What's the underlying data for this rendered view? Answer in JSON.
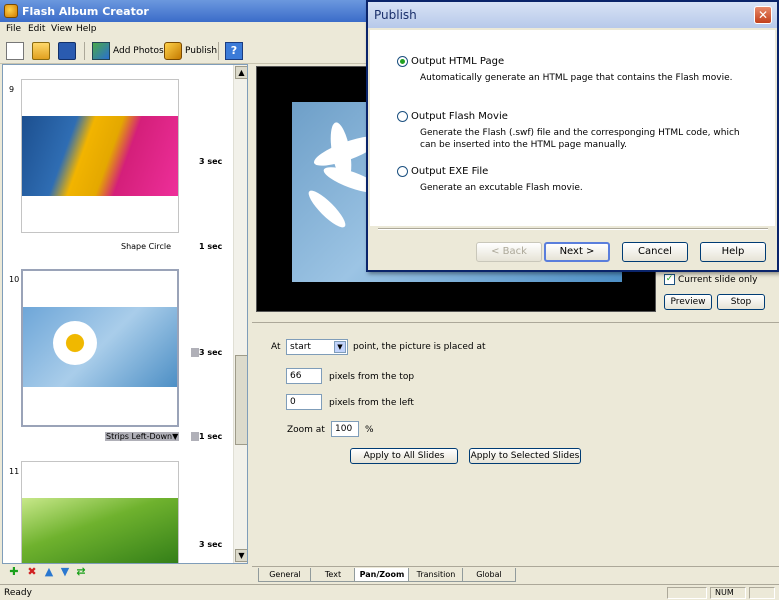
{
  "window": {
    "title": "Flash Album Creator"
  },
  "menu": [
    "File",
    "Edit",
    "View",
    "Help"
  ],
  "toolbar": {
    "add_photos": "Add Photos",
    "publish": "Publish"
  },
  "slides": [
    {
      "num": "9",
      "duration": "3 sec",
      "transition": "Shape Circle",
      "transition_duration": "1 sec"
    },
    {
      "num": "10",
      "duration": "3 sec",
      "transition": "Strips Left-Down▼",
      "transition_duration": "1 sec"
    },
    {
      "num": "11",
      "duration": "3 sec"
    }
  ],
  "preview": {
    "current_slide_only": "Current slide only",
    "preview_btn": "Preview",
    "stop_btn": "Stop"
  },
  "panzoom": {
    "at_label": "At",
    "point_select": "start",
    "point_suffix": "point, the picture is placed at",
    "top_value": "66",
    "top_label": "pixels from the top",
    "left_value": "0",
    "left_label": "pixels from the left",
    "zoom_label": "Zoom at",
    "zoom_value": "100",
    "zoom_unit": "%",
    "apply_all": "Apply to All Slides",
    "apply_selected": "Apply to Selected Slides"
  },
  "tabs": [
    "General",
    "Text",
    "Pan/Zoom",
    "Transition",
    "Global"
  ],
  "status": {
    "text": "Ready",
    "num": "NUM"
  },
  "dialog": {
    "title": "Publish",
    "options": [
      {
        "label": "Output HTML Page",
        "desc": "Automatically generate an HTML page that contains the Flash movie."
      },
      {
        "label": "Output Flash Movie",
        "desc": "Generate the Flash (.swf) file and the corresponging HTML code, which can be inserted into the HTML page manually."
      },
      {
        "label": "Output EXE File",
        "desc": "Generate an excutable Flash movie."
      }
    ],
    "back": "< Back",
    "next": "Next >",
    "cancel": "Cancel",
    "help": "Help"
  }
}
